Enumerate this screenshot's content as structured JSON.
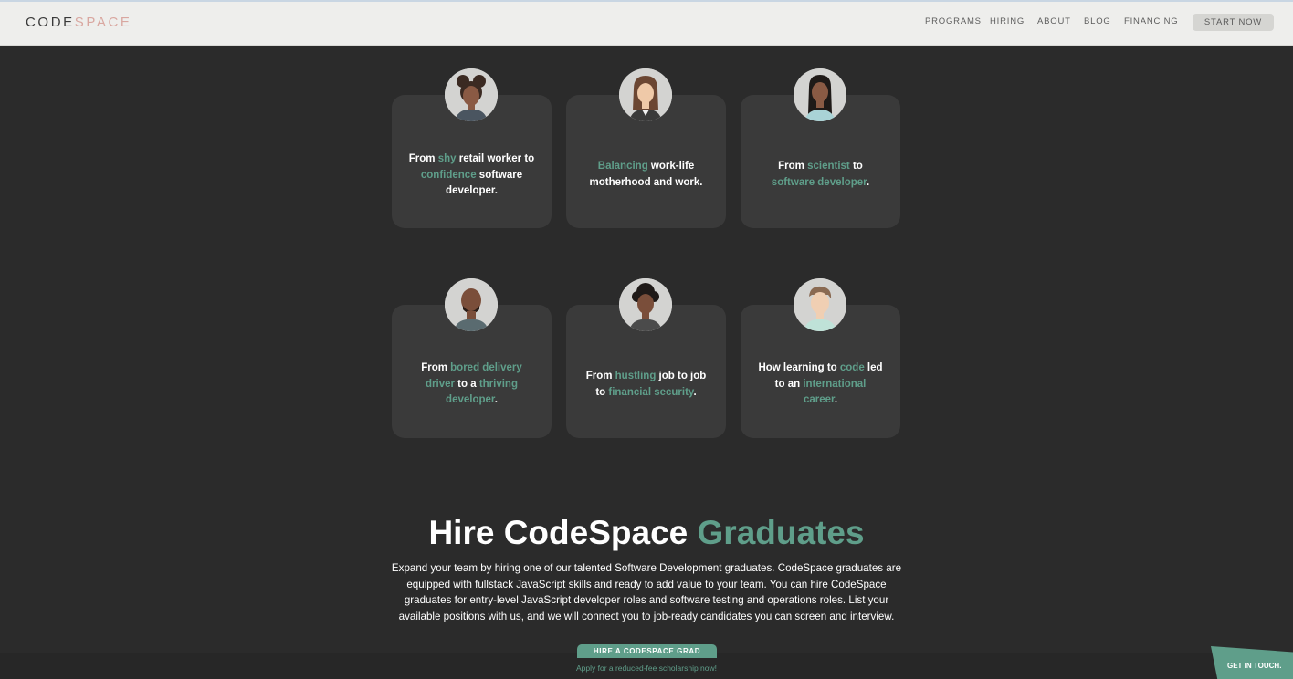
{
  "header": {
    "logo_main": "CODE",
    "logo_accent": "SPACE",
    "nav": [
      "PROGRAMS",
      "HIRING",
      "ABOUT",
      "BLOG",
      "FINANCING"
    ],
    "cta": "START NOW"
  },
  "stories": [
    {
      "parts": [
        "From ",
        "shy",
        " retail worker to ",
        "confidence",
        " software developer."
      ]
    },
    {
      "parts": [
        "",
        "Balancing",
        " work-life motherhood and work."
      ]
    },
    {
      "parts": [
        "From ",
        "scientist",
        " to ",
        "software developer",
        "."
      ]
    },
    {
      "parts": [
        "From ",
        "bored delivery driver",
        " to a ",
        "thriving developer",
        "."
      ]
    },
    {
      "parts": [
        "From ",
        "hustling",
        " job to job to ",
        "financial security",
        "."
      ]
    },
    {
      "parts": [
        "How learning to ",
        "code",
        " led to an ",
        "international career",
        "."
      ]
    }
  ],
  "hire": {
    "title_white": "Hire CodeSpace",
    "title_accent": "Graduates",
    "description": "Expand your team by hiring one of our talented Software Development graduates. CodeSpace graduates are equipped with fullstack JavaScript skills and ready to add value to your team. You can hire CodeSpace graduates for entry-level JavaScript developer roles and software testing and operations roles. List your available positions with us, and we will connect you to job-ready candidates you can screen and interview.",
    "button": "HIRE A CODESPACE GRAD"
  },
  "banner": {
    "text": "Apply for a reduced-fee scholarship now!",
    "touch": "GET IN TOUCH."
  },
  "colors": {
    "accent": "#5f9e8a",
    "background": "#2b2b2b",
    "card": "#3a3a3a",
    "header": "#eeeeec"
  }
}
